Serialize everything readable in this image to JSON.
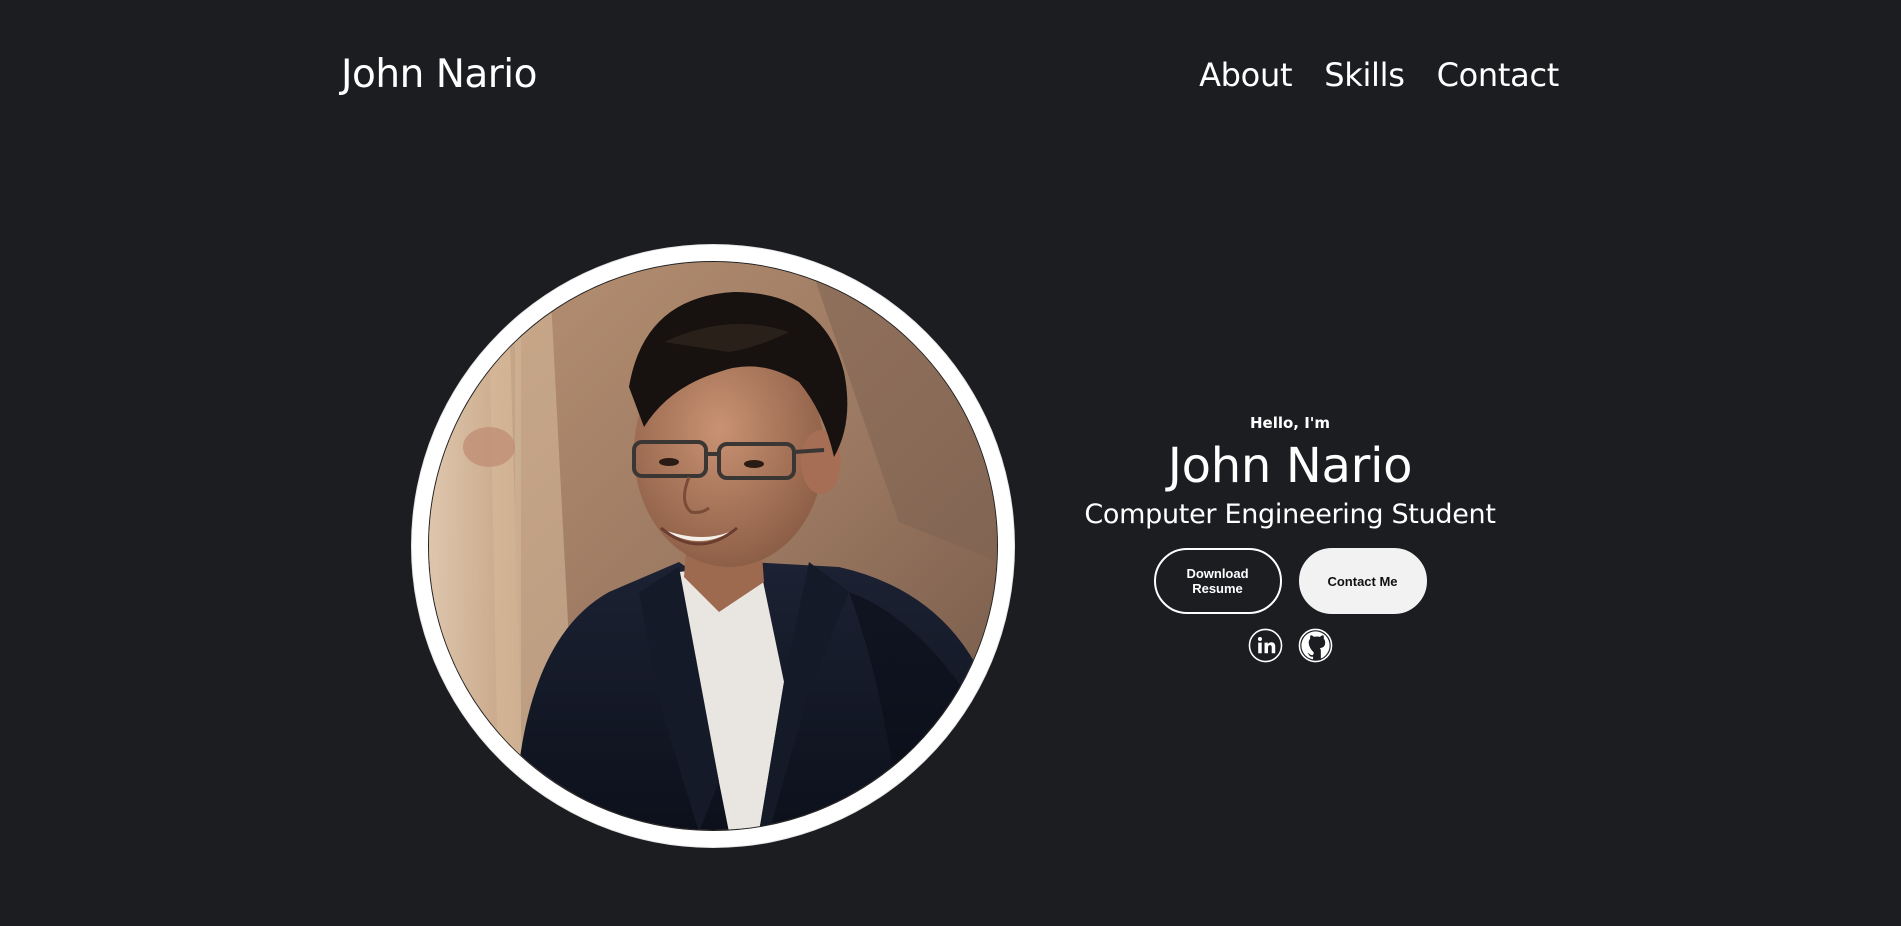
{
  "header": {
    "logo": "John Nario",
    "nav": [
      {
        "label": "About"
      },
      {
        "label": "Skills"
      },
      {
        "label": "Contact"
      }
    ]
  },
  "hero": {
    "greeting": "Hello, I'm",
    "name": "John Nario",
    "role": "Computer Engineering Student",
    "buttons": {
      "resume": "Download Resume",
      "contact": "Contact Me"
    },
    "socials": [
      {
        "icon": "linkedin-icon"
      },
      {
        "icon": "github-icon"
      }
    ]
  },
  "colors": {
    "background": "#1b1d21",
    "text": "#ffffff",
    "button_filled": "#f2f2f2"
  }
}
